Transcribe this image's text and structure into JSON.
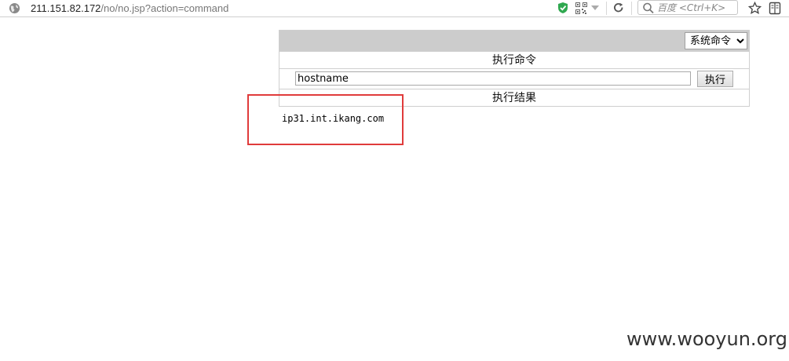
{
  "browser": {
    "url_host": "211.151.82.172",
    "url_path": "/no/no.jsp?action=command",
    "search_placeholder": "百度 <Ctrl+K>"
  },
  "shell": {
    "mode_options": [
      "系统命令"
    ],
    "mode_selected": "系统命令",
    "exec_title": "执行命令",
    "command_value": "hostname",
    "exec_button": "执行",
    "result_title": "执行结果",
    "output": "ip31.int.ikang.com"
  },
  "watermark": "www.wooyun.org",
  "colors": {
    "header_bar": "#cccccc",
    "highlight_box": "#e03b3b",
    "border": "#cfcfcf"
  }
}
